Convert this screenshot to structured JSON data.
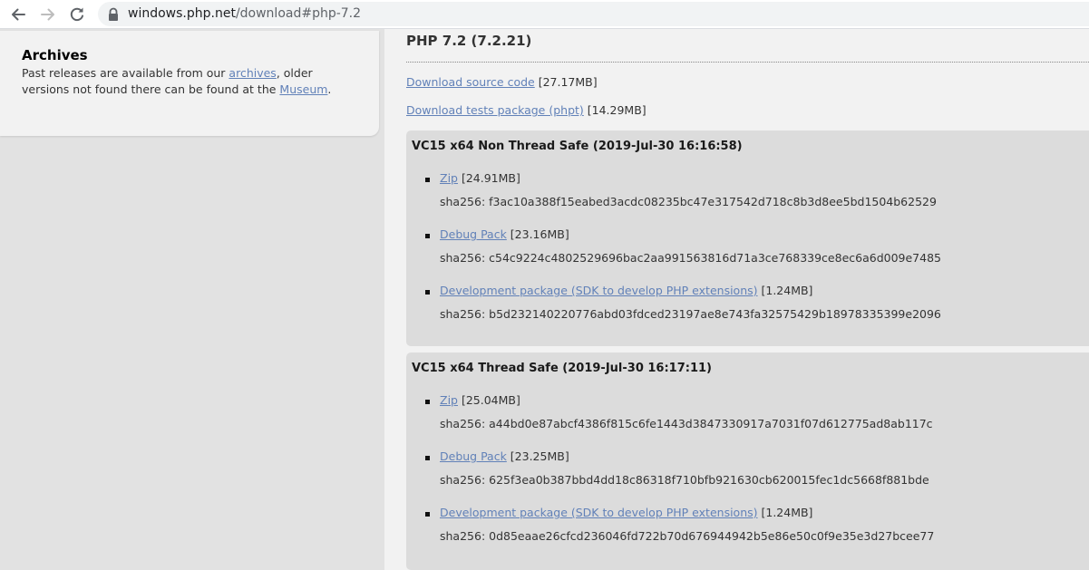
{
  "browser": {
    "url_host": "windows.php.net",
    "url_path": "/download#php-7.2"
  },
  "archives": {
    "title": "Archives",
    "text_before": "Past releases are available from our ",
    "archives_link": "archives",
    "text_middle": ", older versions not found there can be found at the ",
    "museum_link": "Museum",
    "text_after": "."
  },
  "release": {
    "title": "PHP 7.2 (7.2.21)",
    "source": {
      "label": "Download source code",
      "size": " [27.17MB]"
    },
    "tests": {
      "label": "Download tests package (phpt)",
      "size": " [14.29MB]"
    }
  },
  "builds": [
    {
      "title": "VC15 x64 Non Thread Safe (2019-Jul-30 16:16:58)",
      "packages": [
        {
          "label": "Zip",
          "size": " [24.91MB]",
          "sha": "sha256: f3ac10a388f15eabed3acdc08235bc47e317542d718c8b3d8ee5bd1504b62529"
        },
        {
          "label": "Debug Pack",
          "size": " [23.16MB]",
          "sha": "sha256: c54c9224c4802529696bac2aa991563816d71a3ce768339ce8ec6a6d009e7485"
        },
        {
          "label": "Development package (SDK to develop PHP extensions)",
          "size": " [1.24MB]",
          "sha": "sha256: b5d232140220776abd03fdced23197ae8e743fa32575429b18978335399e2096"
        }
      ]
    },
    {
      "title": "VC15 x64 Thread Safe (2019-Jul-30 16:17:11)",
      "packages": [
        {
          "label": "Zip",
          "size": " [25.04MB]",
          "sha": "sha256: a44bd0e87abcf4386f815c6fe1443d3847330917a7031f07d612775ad8ab117c"
        },
        {
          "label": "Debug Pack",
          "size": " [23.25MB]",
          "sha": "sha256: 625f3ea0b387bbd4dd18c86318f710bfb921630cb620015fec1dc5668f881bde"
        },
        {
          "label": "Development package (SDK to develop PHP extensions)",
          "size": " [1.24MB]",
          "sha": "sha256: 0d85eaae26cfcd236046fd722b70d676944942b5e86e50c0f9e35e3d27bcee77"
        }
      ]
    }
  ]
}
